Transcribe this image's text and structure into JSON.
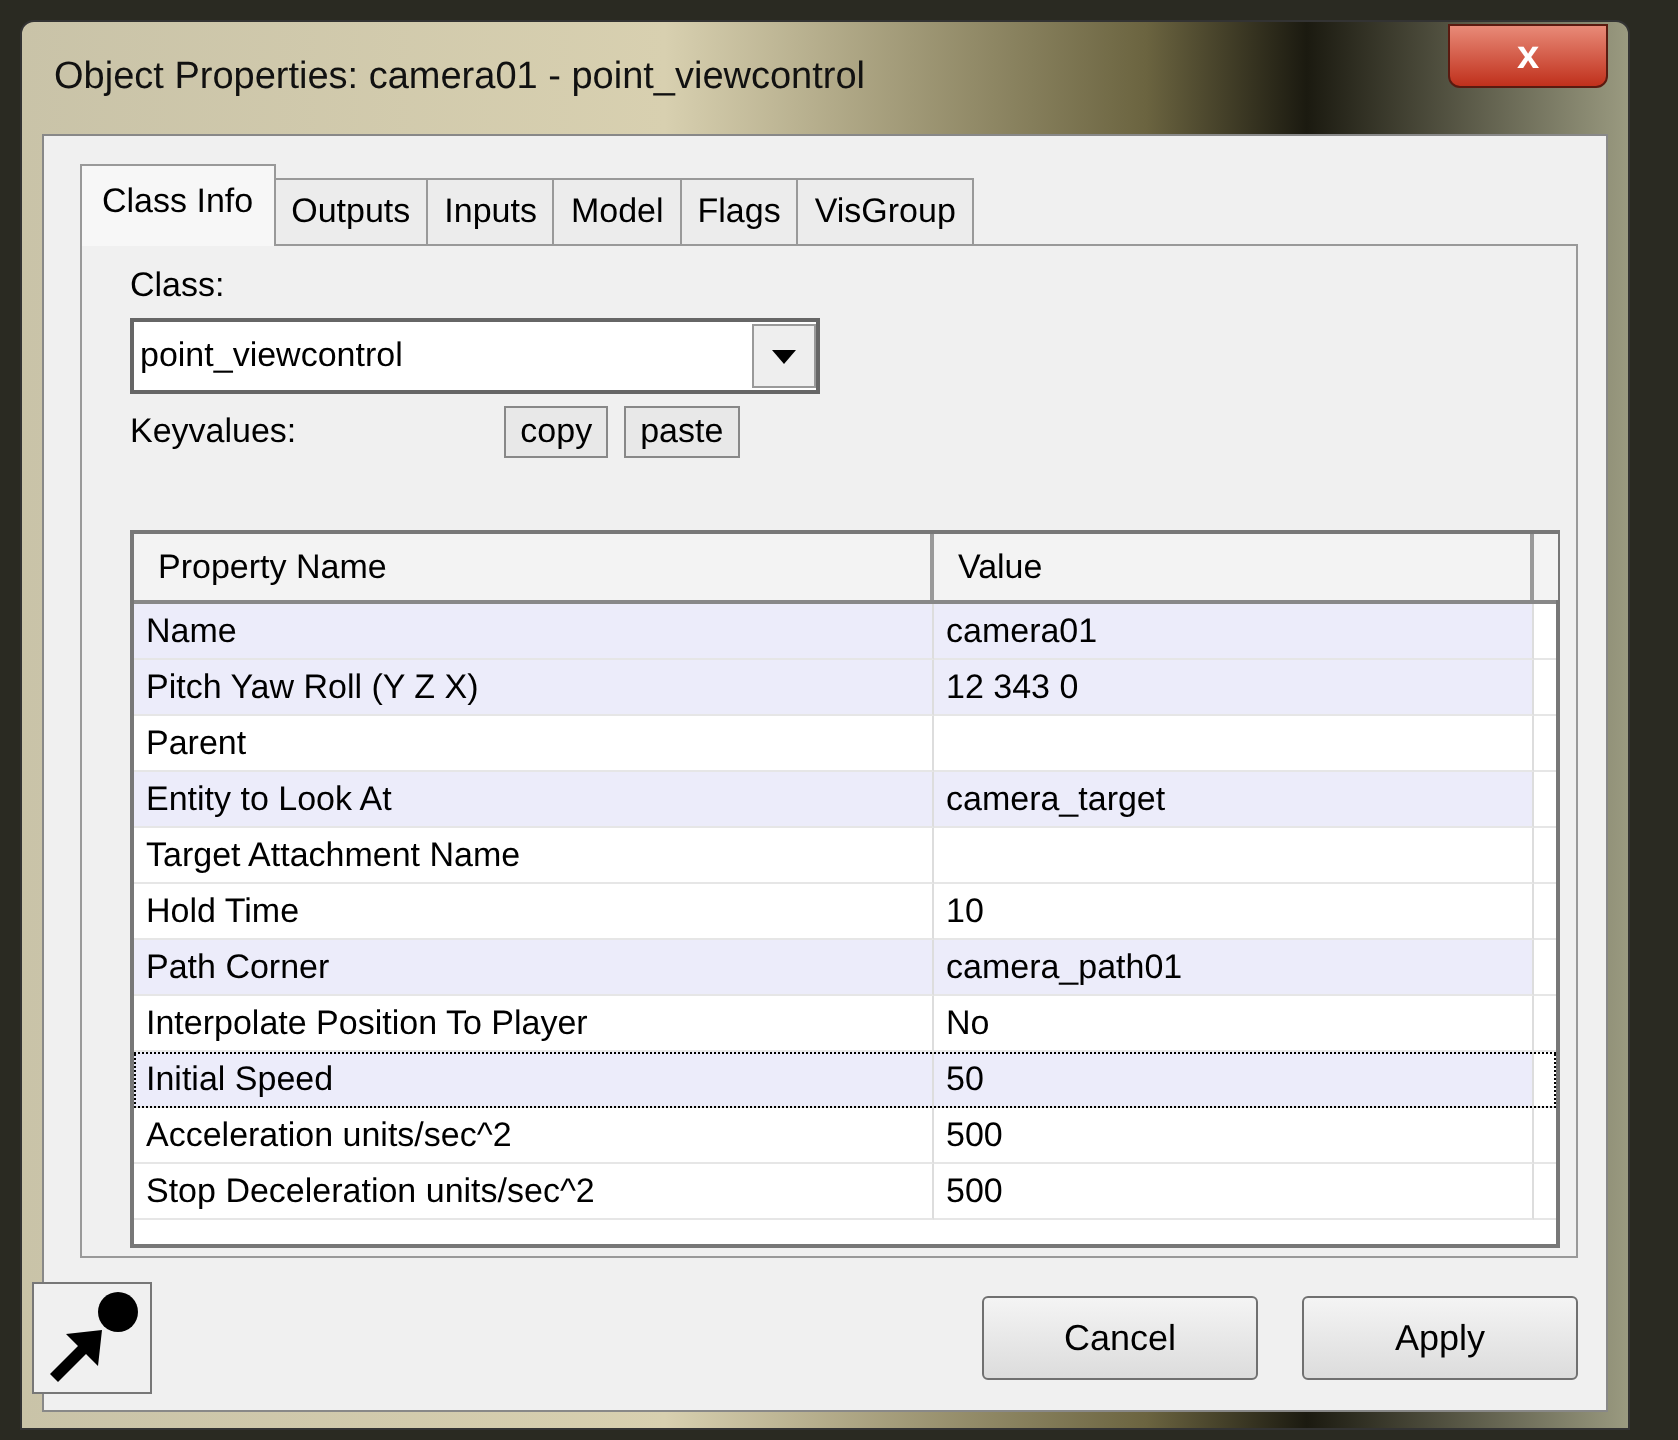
{
  "window": {
    "title": "Object Properties: camera01 - point_viewcontrol",
    "close": "x"
  },
  "tabs": [
    {
      "label": "Class Info",
      "selected": true
    },
    {
      "label": "Outputs",
      "selected": false
    },
    {
      "label": "Inputs",
      "selected": false
    },
    {
      "label": "Model",
      "selected": false
    },
    {
      "label": "Flags",
      "selected": false
    },
    {
      "label": "VisGroup",
      "selected": false
    }
  ],
  "class_label": "Class:",
  "class_select": {
    "value": "point_viewcontrol"
  },
  "keyvalues_label": "Keyvalues:",
  "keyvalue_buttons": [
    "copy",
    "paste"
  ],
  "table": {
    "columns": [
      "Property Name",
      "Value"
    ],
    "rows": [
      {
        "name": "Name",
        "value": "camera01",
        "highlighted": true,
        "selected": false
      },
      {
        "name": "Pitch Yaw Roll (Y Z X)",
        "value": "12 343 0",
        "highlighted": true,
        "selected": false
      },
      {
        "name": "Parent",
        "value": "",
        "highlighted": false,
        "selected": false
      },
      {
        "name": "Entity to Look At",
        "value": "camera_target",
        "highlighted": true,
        "selected": false
      },
      {
        "name": "Target Attachment Name",
        "value": "",
        "highlighted": false,
        "selected": false
      },
      {
        "name": "Hold Time",
        "value": "10",
        "highlighted": false,
        "selected": false
      },
      {
        "name": "Path Corner",
        "value": "camera_path01",
        "highlighted": true,
        "selected": false
      },
      {
        "name": "Interpolate Position To Player",
        "value": "No",
        "highlighted": false,
        "selected": false
      },
      {
        "name": "Initial Speed",
        "value": "50",
        "highlighted": true,
        "selected": true
      },
      {
        "name": "Acceleration units/sec^2",
        "value": "500",
        "highlighted": false,
        "selected": false
      },
      {
        "name": "Stop Deceleration units/sec^2",
        "value": "500",
        "highlighted": false,
        "selected": false
      }
    ]
  },
  "buttons": [
    "Cancel",
    "Apply"
  ]
}
